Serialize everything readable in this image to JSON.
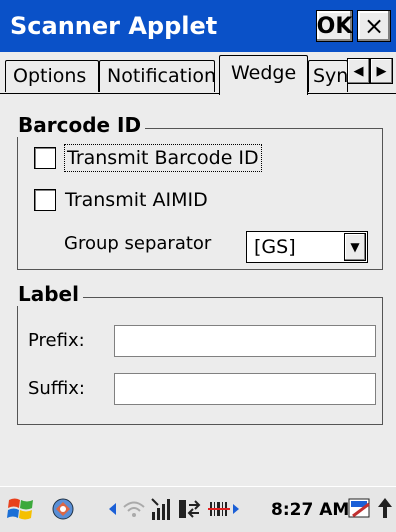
{
  "window": {
    "title": "Scanner Applet",
    "ok_label": "OK",
    "close_label": "×"
  },
  "tabs": [
    {
      "label": "Options",
      "active": false
    },
    {
      "label": "Notification",
      "active": false
    },
    {
      "label": "Wedge",
      "active": true
    },
    {
      "label": "Syn",
      "active": false
    }
  ],
  "tab_scroll": {
    "left": "◀",
    "right": "▶"
  },
  "barcode_id": {
    "legend": "Barcode ID",
    "transmit_barcode_id": {
      "label": "Transmit Barcode ID",
      "checked": false
    },
    "transmit_aimid": {
      "label": "Transmit AIMID",
      "checked": false
    },
    "group_separator": {
      "label": "Group separator",
      "value": "[GS]"
    }
  },
  "label_group": {
    "legend": "Label",
    "prefix": {
      "label": "Prefix:",
      "value": ""
    },
    "suffix": {
      "label": "Suffix:",
      "value": ""
    }
  },
  "taskbar": {
    "time": "8:27 AM"
  },
  "colors": {
    "titlebar": "#0a51c8",
    "background": "#ececec"
  }
}
